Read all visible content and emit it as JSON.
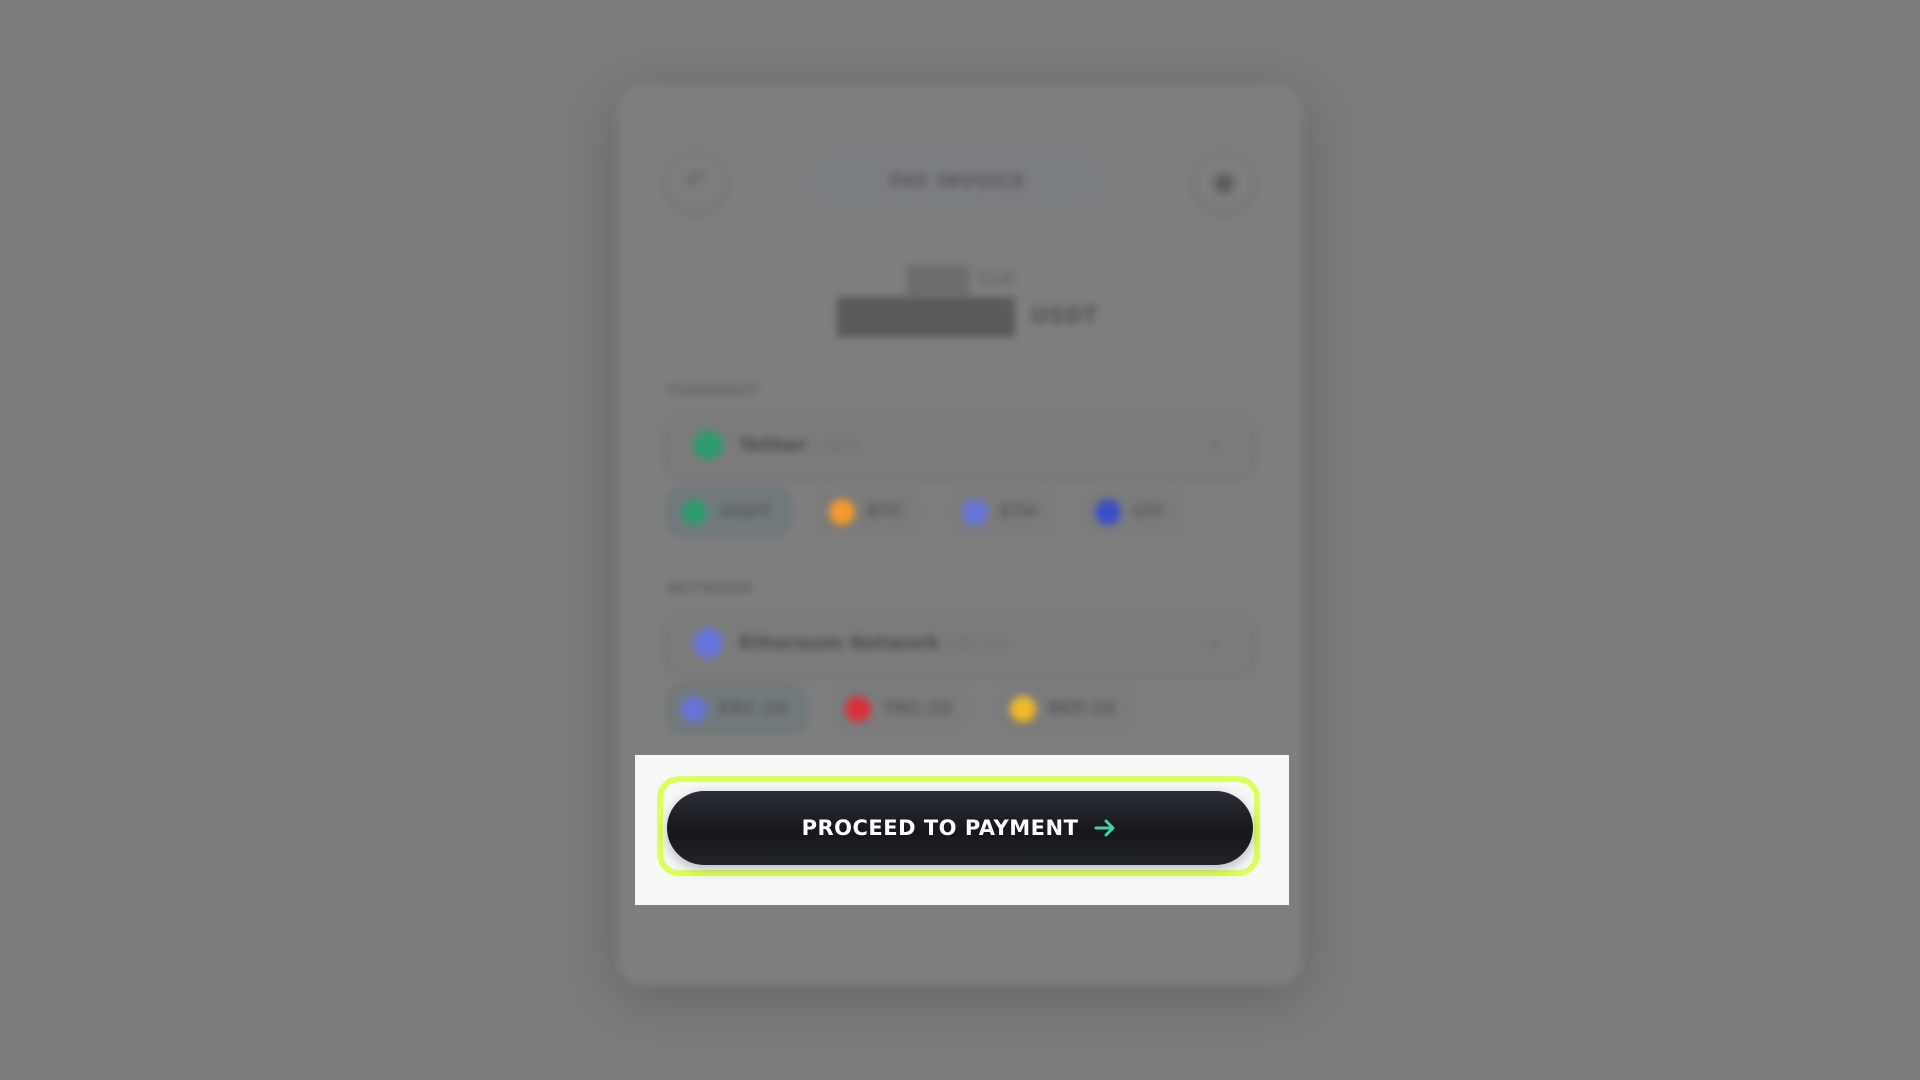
{
  "header": {
    "title": "PAY INVOICE",
    "back_icon": "undo-arrow-icon",
    "settings_icon": "gear-icon"
  },
  "amount": {
    "fiat_currency": "EUR",
    "crypto_currency": "USDT"
  },
  "currency": {
    "label": "CURRENCY",
    "selected_name": "Tether",
    "selected_code": "USDT",
    "options": [
      {
        "code": "USDT",
        "color": "#2e9b6e"
      },
      {
        "code": "BTC",
        "color": "#f29a2b"
      },
      {
        "code": "ETH",
        "color": "#6574d8"
      },
      {
        "code": "LTC",
        "color": "#3b4fc8"
      }
    ]
  },
  "network": {
    "label": "NETWORK",
    "selected_name": "Ethereum Network",
    "selected_code": "ERC-20",
    "options": [
      {
        "code": "ERC-20",
        "color": "#6574d8"
      },
      {
        "code": "TRC-20",
        "color": "#d8323b"
      },
      {
        "code": "BEP-20",
        "color": "#f0b92a"
      }
    ]
  },
  "action": {
    "proceed_label": "PROCEED TO PAYMENT",
    "arrow_icon": "arrow-right-icon",
    "arrow_color": "#3dd6a0",
    "highlight_color": "#dcff5c"
  }
}
